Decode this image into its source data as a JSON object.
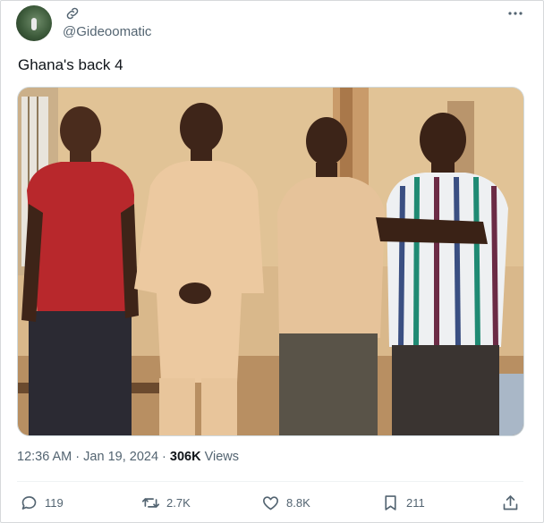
{
  "author": {
    "handle": "@Gideoomatic",
    "avatar": "avatar-image",
    "link_icon": "link-icon"
  },
  "menu_icon": "more-icon",
  "tweet": {
    "text": "Ghana's back 4"
  },
  "meta": {
    "time": "12:36 AM",
    "separator": " · ",
    "date": "Jan 19, 2024",
    "views_count": "306K",
    "views_label": "Views"
  },
  "actions": {
    "reply": {
      "icon": "reply-icon",
      "count": "119"
    },
    "retweet": {
      "icon": "retweet-icon",
      "count": "2.7K"
    },
    "like": {
      "icon": "heart-icon",
      "count": "8.8K"
    },
    "bookmark": {
      "icon": "bookmark-icon",
      "count": "211"
    },
    "share": {
      "icon": "share-icon"
    }
  },
  "colors": {
    "text": "#0f1419",
    "secondary": "#536471",
    "border": "#cfd9de"
  }
}
